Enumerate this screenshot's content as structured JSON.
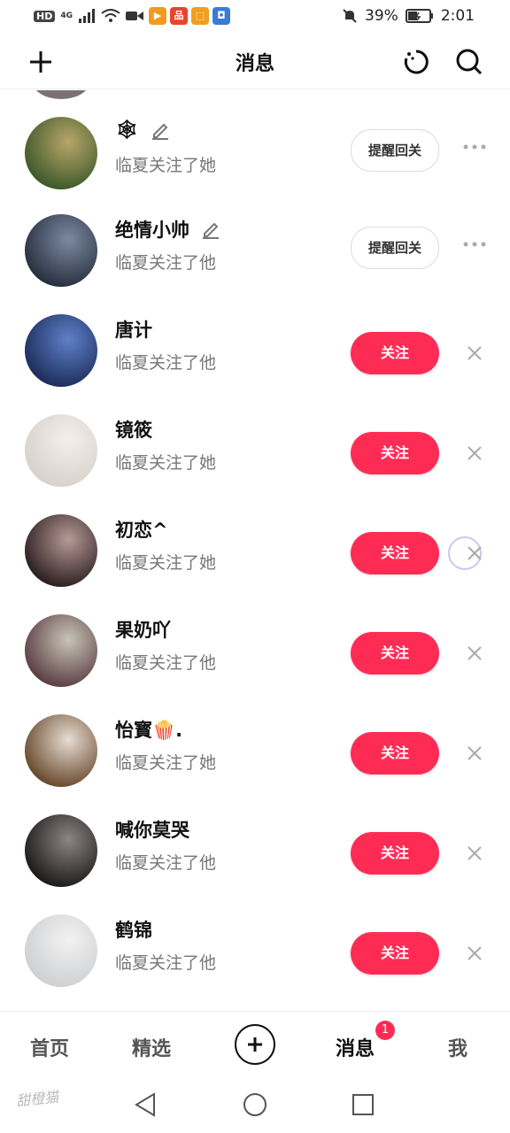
{
  "status_bar": {
    "network_label": "HD",
    "signal_label": "4G",
    "apps": [
      {
        "glyph": "▶",
        "color": "#f39a1e",
        "name": "video-app-icon"
      },
      {
        "glyph": "品",
        "color": "#e9442b",
        "name": "shop-app-icon"
      },
      {
        "glyph": "⬚",
        "color": "#f0a020",
        "name": "game-app-icon"
      },
      {
        "glyph": "◘",
        "color": "#3a7bd5",
        "name": "blue-app-icon"
      }
    ],
    "battery": "39%",
    "time": "2:01"
  },
  "header": {
    "title": "消息"
  },
  "rows": [
    {
      "name": "🕸",
      "subtitle": "临夏关注了她",
      "action": "提醒回关",
      "type": "remind",
      "edit": true,
      "avatar": [
        "#3e5a2a",
        "#b9a56a"
      ]
    },
    {
      "name": "绝情小帅",
      "subtitle": "临夏关注了他",
      "action": "提醒回关",
      "type": "remind",
      "edit": true,
      "avatar": [
        "#28303f",
        "#7c8aa3"
      ]
    },
    {
      "name": "唐计",
      "subtitle": "临夏关注了他",
      "action": "关注",
      "type": "follow",
      "edit": false,
      "avatar": [
        "#1d2e5c",
        "#5f80c8"
      ]
    },
    {
      "name": "镜筱",
      "subtitle": "临夏关注了她",
      "action": "关注",
      "type": "follow",
      "edit": false,
      "avatar": [
        "#d8d2cc",
        "#f3efeb"
      ]
    },
    {
      "name": "初恋^",
      "subtitle": "临夏关注了她",
      "action": "关注",
      "type": "follow",
      "edit": false,
      "avatar": [
        "#2c2022",
        "#b89a96"
      ],
      "ring": true
    },
    {
      "name": "果奶吖",
      "subtitle": "临夏关注了他",
      "action": "关注",
      "type": "follow",
      "edit": false,
      "avatar": [
        "#5b4045",
        "#c9c4b6"
      ]
    },
    {
      "name": "怡寳🍿.",
      "subtitle": "临夏关注了她",
      "action": "关注",
      "type": "follow",
      "edit": false,
      "avatar": [
        "#6a4a2e",
        "#e7ddd3"
      ]
    },
    {
      "name": "喊你莫哭",
      "subtitle": "临夏关注了他",
      "action": "关注",
      "type": "follow",
      "edit": false,
      "avatar": [
        "#1e1b1b",
        "#8a8583"
      ]
    },
    {
      "name": "鹤锦",
      "subtitle": "临夏关注了他",
      "action": "关注",
      "type": "follow",
      "edit": false,
      "avatar": [
        "#cfd0d2",
        "#f2f2f2"
      ]
    }
  ],
  "bottom_nav": {
    "home": "首页",
    "featured": "精选",
    "messages": "消息",
    "messages_badge": "1",
    "me": "我"
  },
  "watermark": "甜橙猫",
  "colors": {
    "accent": "#fe2c55"
  }
}
